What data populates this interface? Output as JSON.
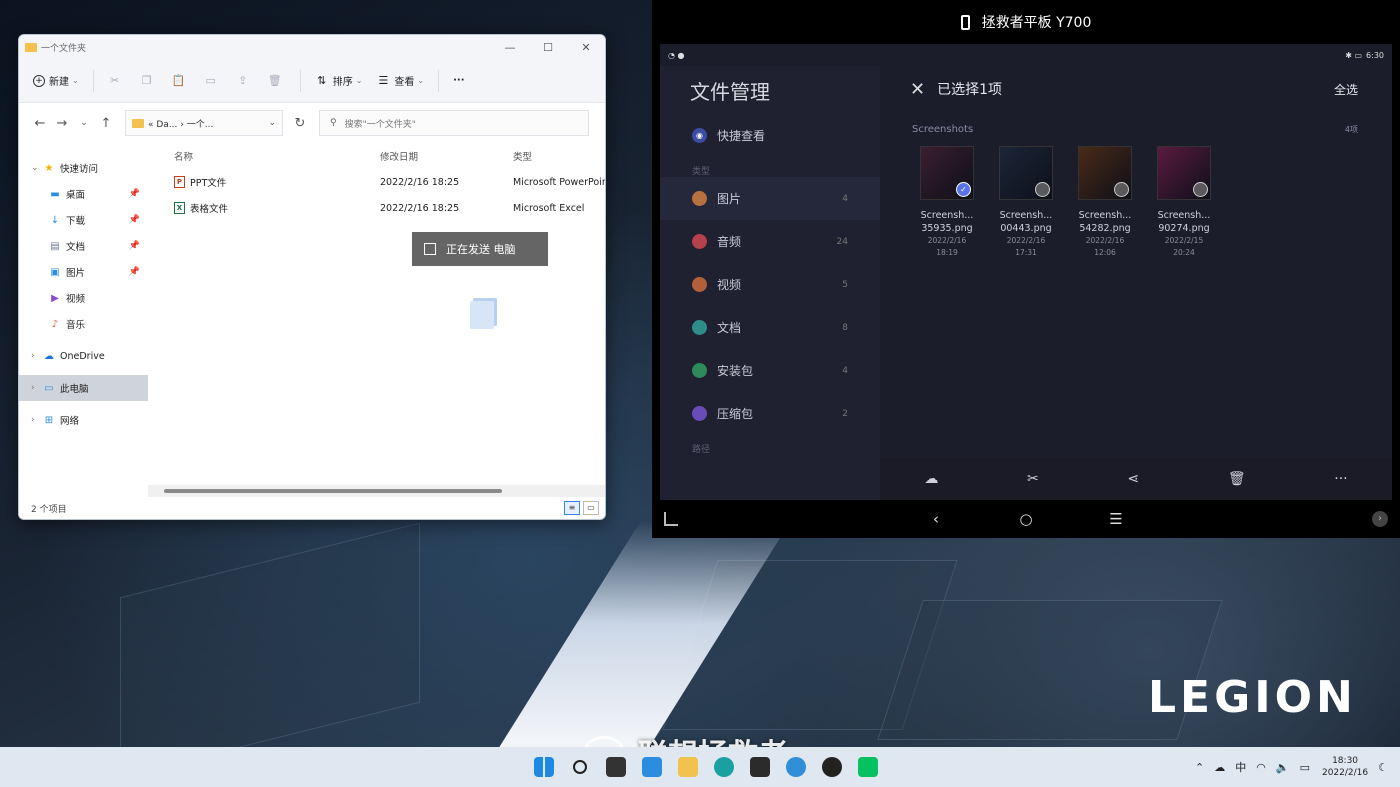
{
  "explorer": {
    "title": "一个文件夹",
    "window_controls": [
      "—",
      "☐",
      "✕"
    ],
    "commands": {
      "new": "新建",
      "sort": "排序",
      "view": "查看",
      "more": "···"
    },
    "address": "« Da... › 一个...",
    "search_placeholder": "搜索\"一个文件夹\"",
    "sidebar": [
      {
        "label": "快速访问",
        "level": 0,
        "pinned": false,
        "selected": false
      },
      {
        "label": "桌面",
        "level": 1,
        "pinned": true,
        "selected": false
      },
      {
        "label": "下载",
        "level": 1,
        "pinned": true,
        "selected": false
      },
      {
        "label": "文档",
        "level": 1,
        "pinned": true,
        "selected": false
      },
      {
        "label": "图片",
        "level": 1,
        "pinned": true,
        "selected": false
      },
      {
        "label": "视频",
        "level": 1,
        "pinned": false,
        "selected": false
      },
      {
        "label": "音乐",
        "level": 1,
        "pinned": false,
        "selected": false
      },
      {
        "label": "OneDrive",
        "level": 0,
        "pinned": false,
        "selected": false
      },
      {
        "label": "此电脑",
        "level": 0,
        "pinned": false,
        "selected": true
      },
      {
        "label": "网络",
        "level": 0,
        "pinned": false,
        "selected": false
      }
    ],
    "columns": {
      "name": "名称",
      "date": "修改日期",
      "type": "类型"
    },
    "files": [
      {
        "name": "PPT文件",
        "date": "2022/2/16 18:25",
        "type": "Microsoft PowerPoint",
        "kind": "ppt"
      },
      {
        "name": "表格文件",
        "date": "2022/2/16 18:25",
        "type": "Microsoft Excel",
        "kind": "xls"
      }
    ],
    "sending_toast": "正在发送 电脑",
    "status": "2 个项目"
  },
  "tablet": {
    "window_title": "拯救者平板 Y700",
    "time": "6:30",
    "app_title": "文件管理",
    "quick_view": "快捷查看",
    "category_header": "类型",
    "categories": [
      {
        "label": "图片",
        "count": "4",
        "color": "#b5713f",
        "selected": true
      },
      {
        "label": "音频",
        "count": "24",
        "color": "#b5414e",
        "selected": false
      },
      {
        "label": "视频",
        "count": "5",
        "color": "#b3603a",
        "selected": false
      },
      {
        "label": "文档",
        "count": "8",
        "color": "#2e8c8a",
        "selected": false
      },
      {
        "label": "安装包",
        "count": "4",
        "color": "#2e8a5a",
        "selected": false
      },
      {
        "label": "压缩包",
        "count": "2",
        "color": "#6a4cb8",
        "selected": false
      }
    ],
    "path_header": "路径",
    "selection_title": "已选择1项",
    "select_all": "全选",
    "group_name": "Screenshots",
    "group_count": "4项",
    "thumbnails": [
      {
        "line1": "Screensh...",
        "line2": "35935.png",
        "date": "2022/2/16",
        "time": "18:19",
        "selected": true,
        "tint": "#3a1f2f"
      },
      {
        "line1": "Screensh...",
        "line2": "00443.png",
        "date": "2022/2/16",
        "time": "17:31",
        "selected": false,
        "tint": "#1b2638"
      },
      {
        "line1": "Screensh...",
        "line2": "54282.png",
        "date": "2022/2/16",
        "time": "12:06",
        "selected": false,
        "tint": "#4a2a18"
      },
      {
        "line1": "Screensh...",
        "line2": "90274.png",
        "date": "2022/2/15",
        "time": "20:24",
        "selected": false,
        "tint": "#5a1a40"
      }
    ],
    "actions": [
      "upload-icon",
      "cut-icon",
      "share-icon",
      "delete-icon",
      "more-icon"
    ]
  },
  "desktop": {
    "logo": "LEGION",
    "watermark": "联想拯救者"
  },
  "taskbar": {
    "apps": [
      {
        "name": "start-icon",
        "color": "#1e88e5"
      },
      {
        "name": "search-icon",
        "color": "#222222"
      },
      {
        "name": "taskview-icon",
        "color": "#333333"
      },
      {
        "name": "widgets-icon",
        "color": "#2a8de0"
      },
      {
        "name": "explorer-icon",
        "color": "#f2c14e"
      },
      {
        "name": "edge-icon",
        "color": "#1aa0a0"
      },
      {
        "name": "store-icon",
        "color": "#2b2b2b"
      },
      {
        "name": "browser-icon",
        "color": "#2f8fd8"
      },
      {
        "name": "xbox-icon",
        "color": "#222222"
      },
      {
        "name": "wechat-icon",
        "color": "#07c160"
      }
    ],
    "tray_lang": "中",
    "time": "18:30",
    "date": "2022/2/16"
  }
}
